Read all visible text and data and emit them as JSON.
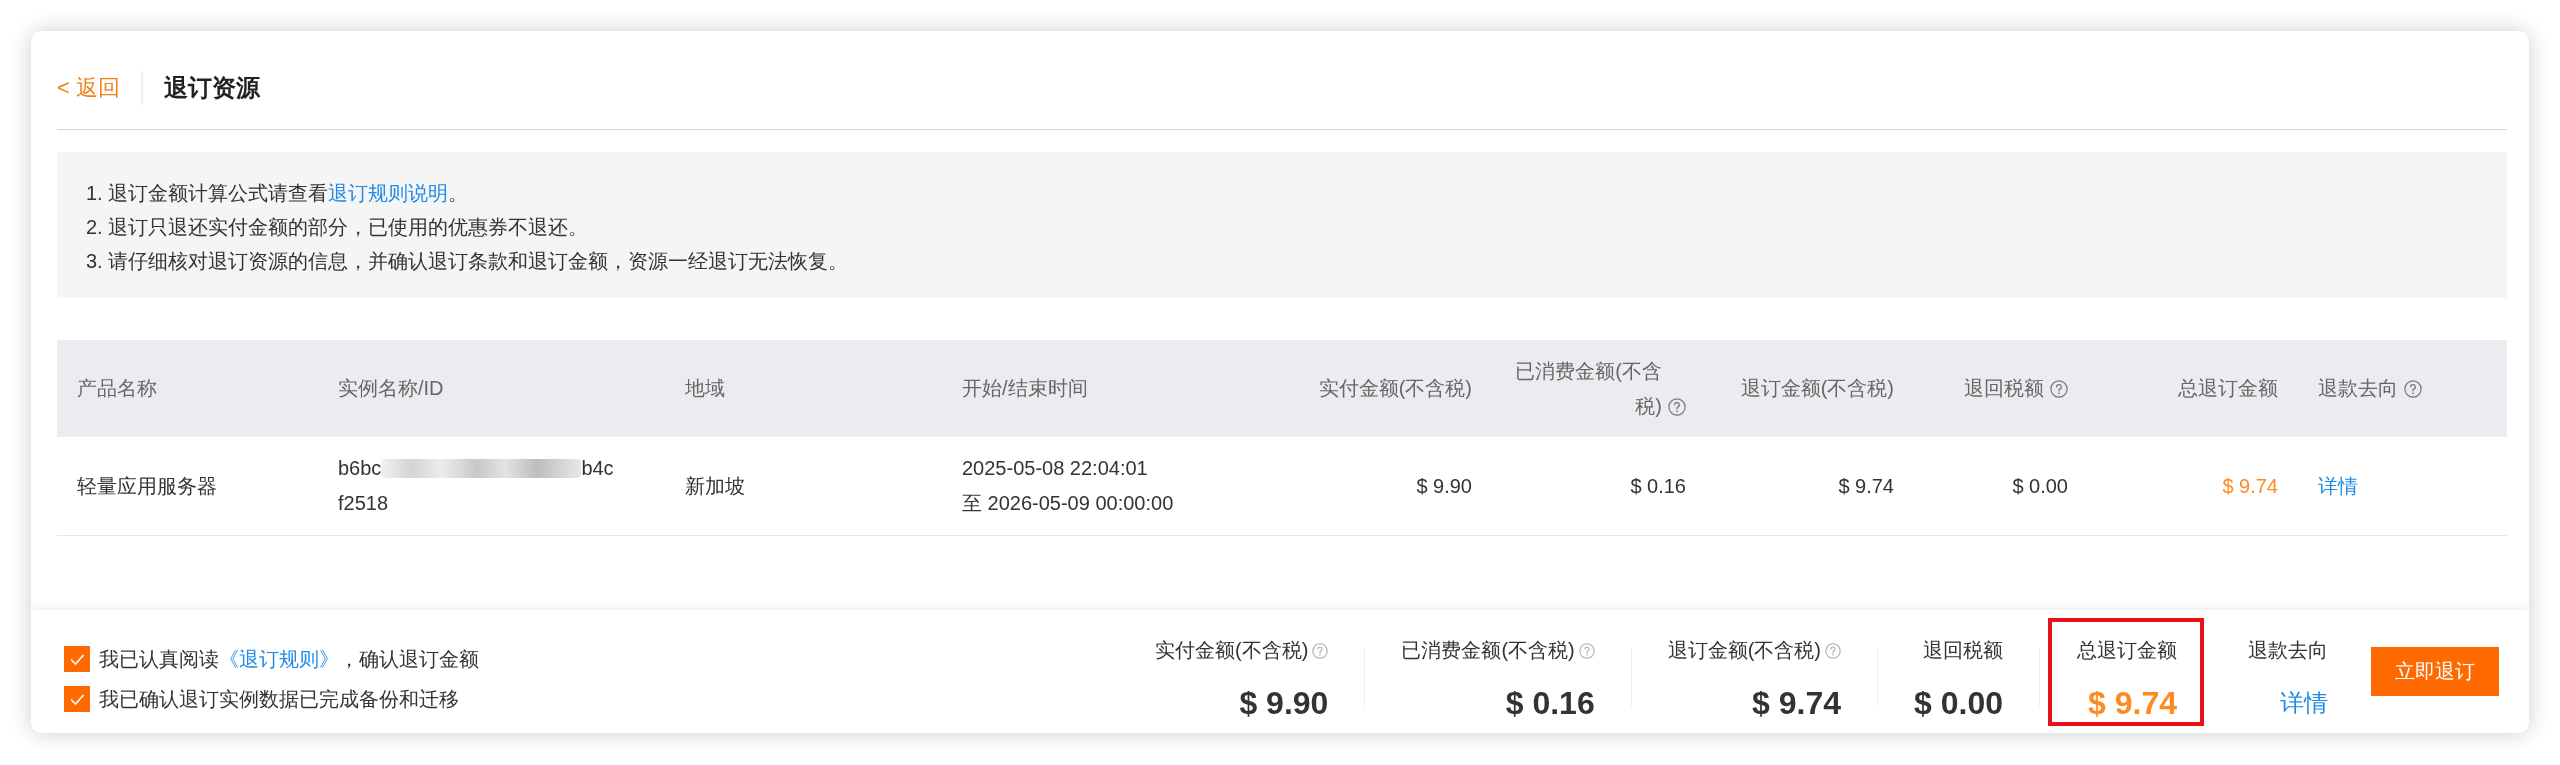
{
  "header": {
    "back_link": "< 返回",
    "title": "退订资源"
  },
  "notice": [
    {
      "text": "1. 退订金额计算公式请查看",
      "link": "退订规则说明",
      "after": "。"
    },
    {
      "text": "2. 退订只退还实付金额的部分，已使用的优惠券不退还。"
    },
    {
      "text": "3. 请仔细核对退订资源的信息，并确认退订条款和退订金额，资源一经退订无法恢复。"
    }
  ],
  "table": {
    "columns": [
      {
        "label": "产品名称",
        "kind": "text",
        "help": false
      },
      {
        "label": "实例名称/ID",
        "kind": "instance",
        "help": false
      },
      {
        "label": "地域",
        "kind": "text",
        "help": false
      },
      {
        "label": "开始/结束时间",
        "kind": "time",
        "help": false
      },
      {
        "label": "实付金额(不含税)",
        "kind": "amount",
        "help": false
      },
      {
        "label": "已消费金额(不含税)",
        "kind": "amount",
        "help": true
      },
      {
        "label": "退订金额(不含税)",
        "kind": "amount",
        "help": false
      },
      {
        "label": "退回税额",
        "kind": "amount",
        "help": true
      },
      {
        "label": "总退订金额",
        "kind": "total",
        "help": false
      },
      {
        "label": "退款去向",
        "kind": "link",
        "help": true
      }
    ],
    "rows": [
      {
        "cells": [
          "轻量应用服务器",
          {
            "prefix": "b6bc",
            "redacted": true,
            "suffix": "b4c",
            "second_line": "f2518"
          },
          "新加坡",
          [
            "2025-05-08 22:04:01",
            "至 2026-05-09 00:00:00"
          ],
          "$ 9.90",
          "$ 0.16",
          "$ 9.74",
          "$ 0.00",
          "$ 9.74",
          "详情"
        ]
      }
    ]
  },
  "agreements": [
    {
      "checked": true,
      "text": "我已认真阅读",
      "link": "《退订规则》",
      "after": "，确认退订金额"
    },
    {
      "checked": true,
      "text": "我已确认退订实例数据已完成备份和迁移"
    }
  ],
  "summary": [
    {
      "label": "实付金额(不含税)",
      "help": true,
      "value": "$ 9.90",
      "kind": "amount",
      "highlighted": false
    },
    {
      "label": "已消费金额(不含税)",
      "help": true,
      "value": "$ 0.16",
      "kind": "amount",
      "highlighted": false
    },
    {
      "label": "退订金额(不含税)",
      "help": true,
      "value": "$ 9.74",
      "kind": "amount",
      "highlighted": false
    },
    {
      "label": "退回税额",
      "help": false,
      "value": "$ 0.00",
      "kind": "amount",
      "highlighted": false
    },
    {
      "label": "总退订金额",
      "help": false,
      "value": "$ 9.74",
      "kind": "total",
      "highlighted": true
    },
    {
      "label": "退款去向",
      "help": false,
      "value": "详情",
      "kind": "link",
      "highlighted": false
    }
  ],
  "submit_button": "立即退订"
}
